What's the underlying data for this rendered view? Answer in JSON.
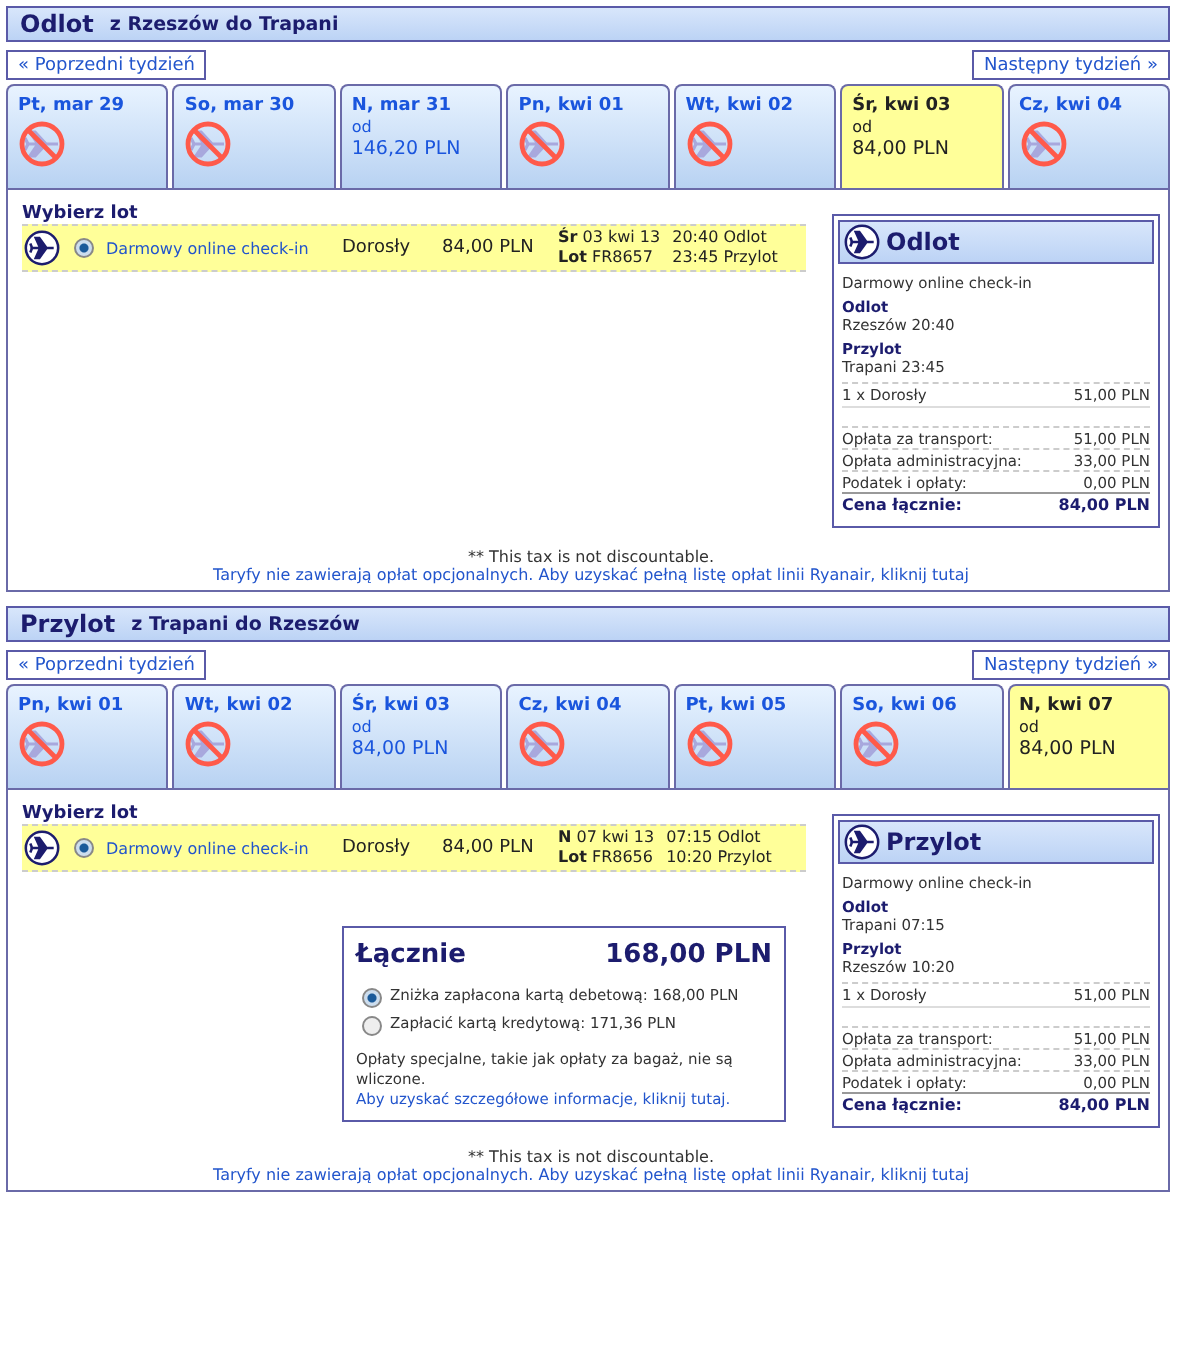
{
  "sections": [
    {
      "title": "Odlot",
      "route": "z Rzeszów do Trapani",
      "prev_week": "« Poprzedni tydzień",
      "next_week": "Następny tydzień »",
      "days": [
        {
          "label": "Pt, mar 29",
          "available": false,
          "selected": false
        },
        {
          "label": "So, mar 30",
          "available": false,
          "selected": false
        },
        {
          "label": "N, mar 31",
          "available": true,
          "from": "od",
          "price": "146,20 PLN",
          "selected": false
        },
        {
          "label": "Pn, kwi 01",
          "available": false,
          "selected": false
        },
        {
          "label": "Wt, kwi 02",
          "available": false,
          "selected": false
        },
        {
          "label": "Śr, kwi 03",
          "available": true,
          "from": "od",
          "price": "84,00 PLN",
          "selected": true
        },
        {
          "label": "Cz, kwi 04",
          "available": false,
          "selected": false
        }
      ],
      "choose_label": "Wybierz lot",
      "flight": {
        "selected": true,
        "fare": "Darmowy online check-in",
        "passenger": "Dorosły",
        "price": "84,00 PLN",
        "date": "**Śr** 03 kwi 13",
        "number": "**Lot** FR8657",
        "departure": "20:40 Odlot",
        "arrival": "23:45 Przylot"
      },
      "summary": {
        "title": "Odlot",
        "fare": "Darmowy online check-in",
        "departure_label": "Odlot",
        "departure": "Rzeszów 20:40",
        "arrival_label": "Przylot",
        "arrival": "Trapani 23:45",
        "lines": [
          {
            "kind": "item",
            "label": "1 x Dorosły",
            "value": "51,00 PLN"
          },
          {
            "kind": "fee",
            "label": "Opłata za transport:",
            "value": "51,00 PLN"
          },
          {
            "kind": "fee",
            "label": "Opłata administracyjna:",
            "value": "33,00 PLN"
          },
          {
            "kind": "fee",
            "label": "Podatek i opłaty:",
            "value": "0,00 PLN"
          },
          {
            "kind": "total",
            "label": "Cena łącznie:",
            "value": "84,00 PLN"
          }
        ]
      },
      "tax_note": "** This tax is not discountable.",
      "fees_link": "Taryfy nie zawierają opłat opcjonalnych. Aby uzyskać pełną listę opłat linii Ryanair, kliknij tutaj"
    },
    {
      "title": "Przylot",
      "route": "z Trapani do Rzeszów",
      "prev_week": "« Poprzedni tydzień",
      "next_week": "Następny tydzień »",
      "days": [
        {
          "label": "Pn, kwi 01",
          "available": false,
          "selected": false
        },
        {
          "label": "Wt, kwi 02",
          "available": false,
          "selected": false
        },
        {
          "label": "Śr, kwi 03",
          "available": true,
          "from": "od",
          "price": "84,00 PLN",
          "selected": false
        },
        {
          "label": "Cz, kwi 04",
          "available": false,
          "selected": false
        },
        {
          "label": "Pt, kwi 05",
          "available": false,
          "selected": false
        },
        {
          "label": "So, kwi 06",
          "available": false,
          "selected": false
        },
        {
          "label": "N, kwi 07",
          "available": true,
          "from": "od",
          "price": "84,00 PLN",
          "selected": true
        }
      ],
      "choose_label": "Wybierz lot",
      "flight": {
        "selected": true,
        "fare": "Darmowy online check-in",
        "passenger": "Dorosły",
        "price": "84,00 PLN",
        "date": "**N** 07 kwi 13",
        "number": "**Lot** FR8656",
        "departure": "07:15 Odlot",
        "arrival": "10:20 Przylot"
      },
      "total": {
        "title": "Łącznie",
        "amount": "168,00 PLN",
        "options": [
          {
            "label": "Zniżka zapłacona kartą debetową: 168,00 PLN",
            "selected": true
          },
          {
            "label": "Zapłacić kartą kredytową: 171,36 PLN",
            "selected": false
          }
        ],
        "note": "Opłaty specjalne, takie jak opłaty za bagaż, nie są wliczone.",
        "note_link": "Aby uzyskać szczegółowe informacje, kliknij tutaj."
      },
      "summary": {
        "title": "Przylot",
        "fare": "Darmowy online check-in",
        "departure_label": "Odlot",
        "departure": "Trapani 07:15",
        "arrival_label": "Przylot",
        "arrival": "Rzeszów 10:20",
        "lines": [
          {
            "kind": "item",
            "label": "1 x Dorosły",
            "value": "51,00 PLN"
          },
          {
            "kind": "fee",
            "label": "Opłata za transport:",
            "value": "51,00 PLN"
          },
          {
            "kind": "fee",
            "label": "Opłata administracyjna:",
            "value": "33,00 PLN"
          },
          {
            "kind": "fee",
            "label": "Podatek i opłaty:",
            "value": "0,00 PLN"
          },
          {
            "kind": "total",
            "label": "Cena łącznie:",
            "value": "84,00 PLN"
          }
        ]
      },
      "tax_note": "** This tax is not discountable.",
      "fees_link": "Taryfy nie zawierają opłat opcjonalnych. Aby uzyskać pełną listę opłat linii Ryanair, kliknij tutaj"
    }
  ]
}
